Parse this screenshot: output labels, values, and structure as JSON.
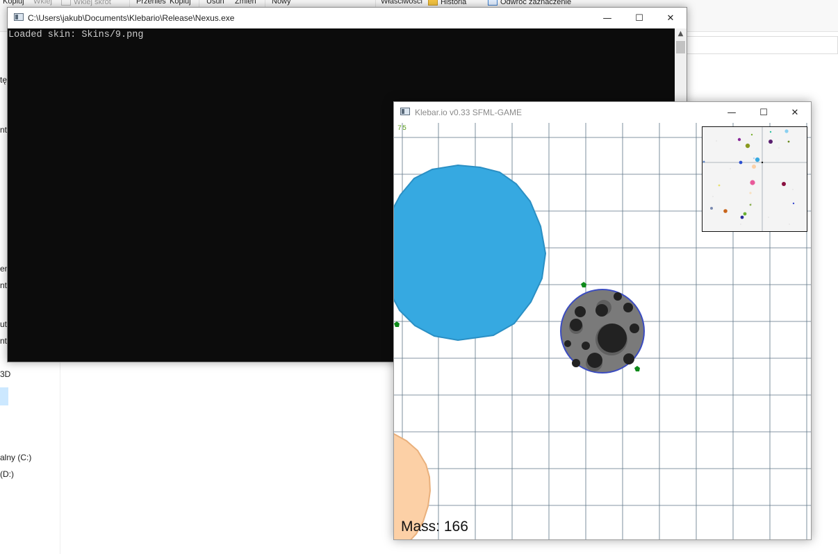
{
  "explorer": {
    "ribbon": {
      "copy_label": "Kopiuj",
      "paste_label": "Wklej",
      "paste_shortcut_label": "Wklej skrót",
      "move_label": "Przenieś",
      "copy_to_label": "Kopiuj",
      "delete_label": "Usuń",
      "rename_label": "Zmień",
      "new_label": "Nowy",
      "properties_label": "Właściwości",
      "history_label": "Historia",
      "invert_label": "Odwróć zaznaczenie"
    },
    "nav": {
      "items": [
        "tę",
        "nty",
        "en",
        "nty",
        "ute",
        "nty",
        "3D",
        "alny (C:)",
        "(D:)"
      ]
    }
  },
  "console": {
    "title": "C:\\Users\\jakub\\Documents\\Klebario\\Release\\Nexus.exe",
    "output": "Loaded skin: Skins/9.png",
    "minimize": "—",
    "maximize": "☐",
    "close": "✕"
  },
  "game": {
    "title": "Klebar.io v0.33 SFML-GAME",
    "fps": "75",
    "mass_text": "Mass: 166",
    "minimize": "—",
    "maximize": "☐",
    "close": "✕",
    "colors": {
      "blue_cell": "#36a9e1",
      "blue_cell_border": "#2a8fc4",
      "player_cell": "#7a7a7a",
      "player_border": "#3b4cc0",
      "peach_cell": "#fcd0a6",
      "peach_border": "#e9b07c",
      "food": "#0e8a1a",
      "grid": "#6a7f90"
    }
  }
}
